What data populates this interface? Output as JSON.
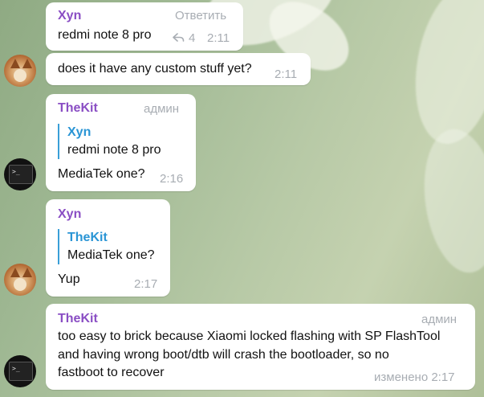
{
  "messages": [
    {
      "sender": "Xyn",
      "action": "Ответить",
      "text": "redmi note 8 pro",
      "reply_count": "4",
      "time": "2:11"
    },
    {
      "text": "does it have any custom stuff yet?",
      "time": "2:11",
      "avatar": "fox-avatar"
    },
    {
      "sender": "TheKit",
      "role": "админ",
      "quote_name": "Xyn",
      "quote_text": "redmi note 8 pro",
      "text": "MediaTek one?",
      "time": "2:16",
      "avatar": "terminal-avatar"
    },
    {
      "sender": "Xyn",
      "quote_name": "TheKit",
      "quote_text": "MediaTek one?",
      "text": "Yup",
      "time": "2:17",
      "avatar": "fox-avatar"
    },
    {
      "sender": "TheKit",
      "role": "админ",
      "lines": [
        "too easy to brick because Xiaomi locked flashing with SP FlashTool",
        "and having wrong boot/dtb will crash the bootloader, so no",
        "fastboot to recover"
      ],
      "time": "изменено 2:17",
      "avatar": "terminal-avatar"
    }
  ],
  "colors": {
    "sender_name": "#8a4ec4",
    "quote_accent": "#2a95d5",
    "meta_text": "#a8adb3"
  }
}
